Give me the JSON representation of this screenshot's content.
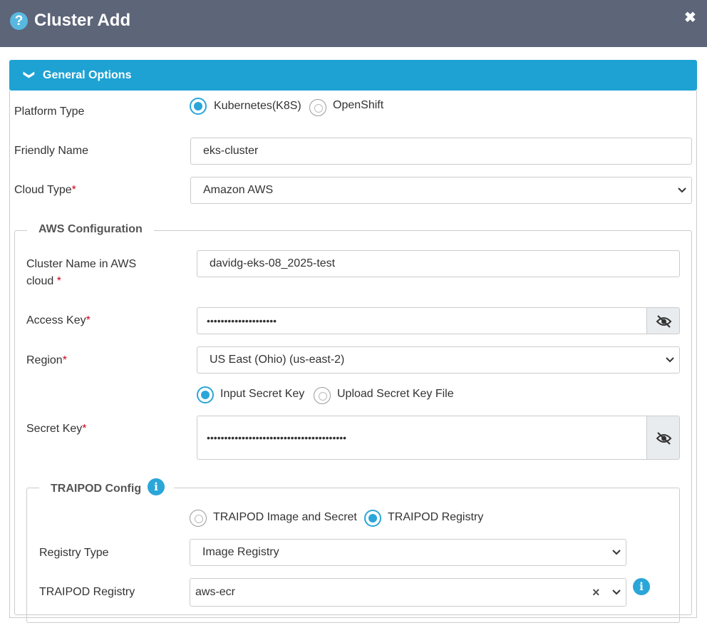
{
  "dialog": {
    "title": "Cluster Add",
    "help_icon": "?",
    "close_icon": "✖"
  },
  "panel": {
    "title": "General Options",
    "chevron": "❯"
  },
  "platform": {
    "label": "Platform Type",
    "options": [
      "Kubernetes(K8S)",
      "OpenShift"
    ],
    "selected": "Kubernetes(K8S)"
  },
  "friendly_name": {
    "label": "Friendly Name",
    "value": "eks-cluster"
  },
  "cloud_type": {
    "label": "Cloud Type",
    "required": "*",
    "value": "Amazon AWS"
  },
  "aws": {
    "legend": "AWS Configuration",
    "cluster_name": {
      "label_line1": "Cluster Name in AWS",
      "label_line2": "cloud",
      "required": "*",
      "value": "davidg-eks-08_2025-test"
    },
    "access_key": {
      "label": "Access Key",
      "required": "*",
      "value": "••••••••••••••••••••"
    },
    "region": {
      "label": "Region",
      "required": "*",
      "value": "US East (Ohio) (us-east-2)"
    },
    "secret_mode": {
      "options": [
        "Input Secret Key",
        "Upload Secret Key File"
      ],
      "selected": "Input Secret Key"
    },
    "secret_key": {
      "label": "Secret Key",
      "required": "*",
      "value": "••••••••••••••••••••••••••••••••••••••••"
    }
  },
  "traipod": {
    "legend": "TRAIPOD Config",
    "mode": {
      "options": [
        "TRAIPOD Image and Secret",
        "TRAIPOD Registry"
      ],
      "selected": "TRAIPOD Registry"
    },
    "registry_type": {
      "label": "Registry Type",
      "value": "Image Registry"
    },
    "registry": {
      "label": "TRAIPOD Registry",
      "value": "aws-ecr",
      "clear": "×"
    }
  },
  "icons": {
    "eye_off": "eye-off-icon",
    "caret": "chevron-down-icon",
    "info": "info-icon"
  },
  "colors": {
    "header_bg": "#5d6579",
    "panel_bg": "#1ea2d3",
    "accent": "#2aa6d8",
    "required": "#d0021b"
  }
}
